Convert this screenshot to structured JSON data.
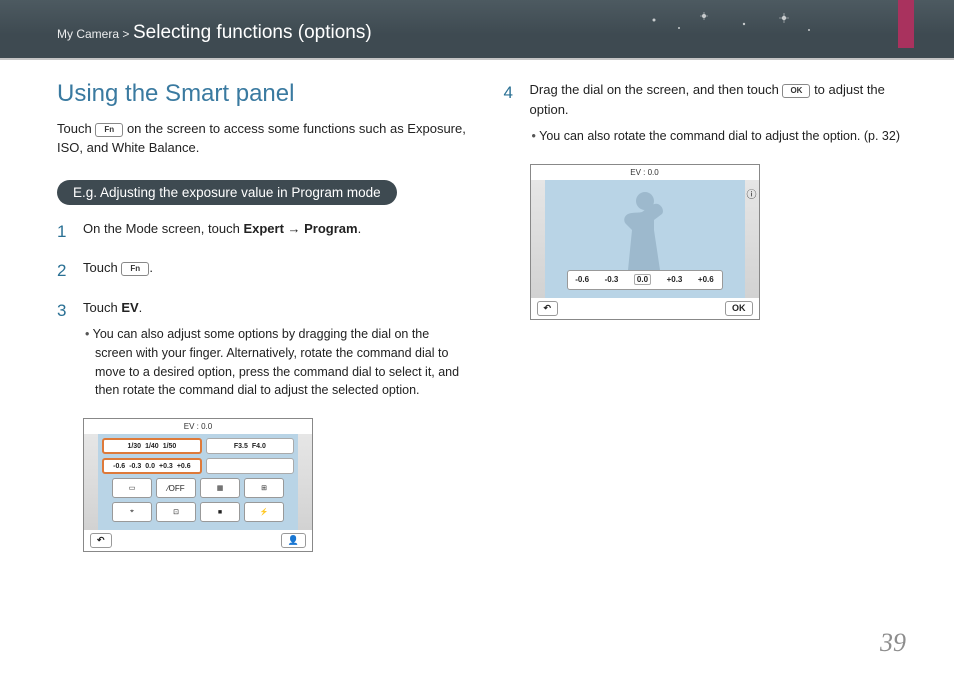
{
  "header": {
    "breadcrumb_prefix": "My Camera >",
    "breadcrumb_title": "Selecting functions (options)"
  },
  "left": {
    "heading": "Using the Smart panel",
    "intro_before": "Touch ",
    "fn_label": "Fn",
    "intro_after": " on the screen to access some functions such as Exposure, ISO, and White Balance.",
    "pill": "E.g. Adjusting the exposure value in Program mode",
    "step1_a": "On the Mode screen, touch ",
    "step1_b": "Expert",
    "step1_c": " → ",
    "step1_d": "Program",
    "step1_e": ".",
    "step2_a": "Touch ",
    "step2_b": ".",
    "step3_a": "Touch ",
    "step3_b": "EV",
    "step3_c": ".",
    "step3_sub": "You can also adjust some options by dragging the dial on the screen with your finger. Alternatively, rotate the command dial to move to a desired option, press the command dial to select it, and then rotate the command dial to adjust the selected option.",
    "scr": {
      "title": "EV : 0.0",
      "shutter": {
        "a": "1/30",
        "b": "1/40",
        "c": "1/50"
      },
      "aperture": {
        "a": "F3.5",
        "b": "F4.0",
        "c": "F4"
      },
      "ev": {
        "a": "-0.6",
        "b": "-0.3",
        "c": "0.0",
        "d": "+0.3",
        "e": "+0.6"
      },
      "back_icon": "↶",
      "person_icon": "👤"
    }
  },
  "right": {
    "num": "4",
    "step4_a": "Drag the dial on the screen, and then touch ",
    "ok_label": "OK",
    "step4_b": " to adjust the option.",
    "step4_sub": "You can also rotate the command dial to adjust the option. (p. 32)",
    "scr": {
      "title": "EV : 0.0",
      "info_icon": "ⓘ",
      "ev": {
        "a": "-0.6",
        "b": "-0.3",
        "c": "0.0",
        "d": "+0.3",
        "e": "+0.6"
      },
      "back_icon": "↶",
      "ok": "OK"
    }
  },
  "page_number": "39"
}
